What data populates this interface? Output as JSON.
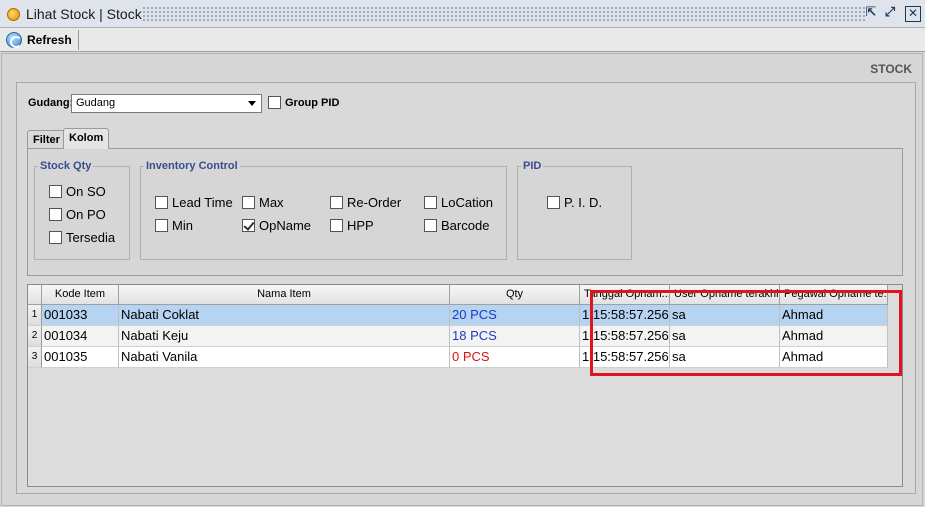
{
  "window": {
    "title": "Lihat Stock | Stock",
    "buttons": [
      "restore-icon",
      "maximize-icon",
      "close-icon"
    ]
  },
  "toolbar": {
    "refresh_label": "Refresh"
  },
  "section_label": "STOCK",
  "gudang": {
    "label": "Gudang:",
    "value": "Gudang"
  },
  "group_pid": {
    "label": "Group PID",
    "checked": false
  },
  "tabs": [
    {
      "label": "Filter",
      "active": false
    },
    {
      "label": "Kolom",
      "active": true
    }
  ],
  "stock_qty": {
    "legend": "Stock Qty",
    "items": [
      {
        "label": "On SO",
        "checked": false
      },
      {
        "label": "On PO",
        "checked": false
      },
      {
        "label": "Tersedia",
        "checked": false
      }
    ]
  },
  "inventory_control": {
    "legend": "Inventory Control",
    "items": [
      {
        "label": "Lead Time",
        "checked": false
      },
      {
        "label": "Max",
        "checked": false
      },
      {
        "label": "Re-Order",
        "checked": false
      },
      {
        "label": "LoCation",
        "checked": false
      },
      {
        "label": "Min",
        "checked": false
      },
      {
        "label": "OpName",
        "checked": true
      },
      {
        "label": "HPP",
        "checked": false
      },
      {
        "label": "Barcode",
        "checked": false
      }
    ]
  },
  "pid": {
    "legend": "PID",
    "items": [
      {
        "label": "P. I. D.",
        "checked": false
      }
    ]
  },
  "grid": {
    "columns": [
      "Kode Item",
      "Nama Item",
      "Qty",
      "Tanggal Opnam...",
      "User Opname terakhir",
      "Pegawai Opname te..."
    ],
    "rows": [
      {
        "num": "1",
        "kode": "001033",
        "nama": "Nabati Coklat",
        "qty": "20 PCS",
        "tanggal": "1 15:58:57.256",
        "user": "sa",
        "pegawai": "Ahmad"
      },
      {
        "num": "2",
        "kode": "001034",
        "nama": "Nabati Keju",
        "qty": "18 PCS",
        "tanggal": "1 15:58:57.256",
        "user": "sa",
        "pegawai": "Ahmad"
      },
      {
        "num": "3",
        "kode": "001035",
        "nama": "Nabati Vanila",
        "qty": "0 PCS",
        "tanggal": "1 15:58:57.256",
        "user": "sa",
        "pegawai": "Ahmad"
      }
    ],
    "qty_colors": [
      "#1a3cc8",
      "#1a3cc8",
      "#e01010"
    ],
    "highlight_color": "#e0141e"
  }
}
